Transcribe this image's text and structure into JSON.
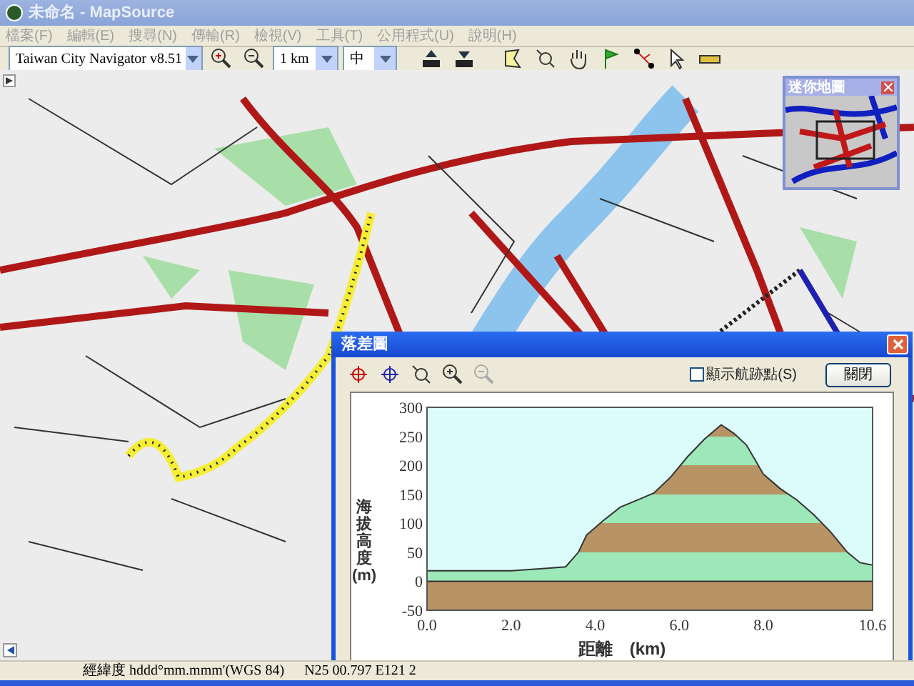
{
  "window": {
    "title": "未命名 - MapSource"
  },
  "menu": [
    "檔案(F)",
    "編輯(E)",
    "搜尋(N)",
    "傳輸(R)",
    "檢視(V)",
    "工具(T)",
    "公用程式(U)",
    "說明(H)"
  ],
  "toolbar": {
    "map_product": "Taiwan City Navigator v8.51",
    "scale": "1 km",
    "detail": "中"
  },
  "mini_map": {
    "title": "迷你地圖"
  },
  "profile_dialog": {
    "title": "落差圖",
    "show_track_points": {
      "label": "顯示航跡點(S)",
      "checked": false
    },
    "close_button": "關閉",
    "chart_data": {
      "type": "area",
      "xlabel": "距離　(km)",
      "ylabel": "海拔高度 (m)",
      "x": [
        0,
        1,
        2,
        2.8,
        3.3,
        3.6,
        3.8,
        4.2,
        4.6,
        5.0,
        5.4,
        5.8,
        6.2,
        6.6,
        7.0,
        7.3,
        7.6,
        8.0,
        8.4,
        8.8,
        9.2,
        9.6,
        10.0,
        10.3,
        10.6
      ],
      "values": [
        18,
        18,
        18,
        22,
        25,
        50,
        80,
        105,
        128,
        140,
        152,
        180,
        215,
        245,
        270,
        255,
        235,
        185,
        160,
        140,
        115,
        85,
        50,
        32,
        28
      ],
      "xlim": [
        0,
        10.6
      ],
      "ylim": [
        -50,
        300
      ],
      "xticks": [
        {
          "value": 0,
          "label": "0.0"
        },
        {
          "value": 2,
          "label": "2.0"
        },
        {
          "value": 4,
          "label": "4.0"
        },
        {
          "value": 6,
          "label": "6.0"
        },
        {
          "value": 8,
          "label": "8.0"
        },
        {
          "value": 10.6,
          "label": "10.6"
        }
      ],
      "yticks": [
        -50,
        0,
        50,
        100,
        150,
        200,
        250,
        300
      ]
    }
  },
  "status_bar": {
    "coordinate_format": "經緯度 hddd°mm.mmm'(WGS 84)",
    "position": "N25 00.797 E121 2"
  }
}
